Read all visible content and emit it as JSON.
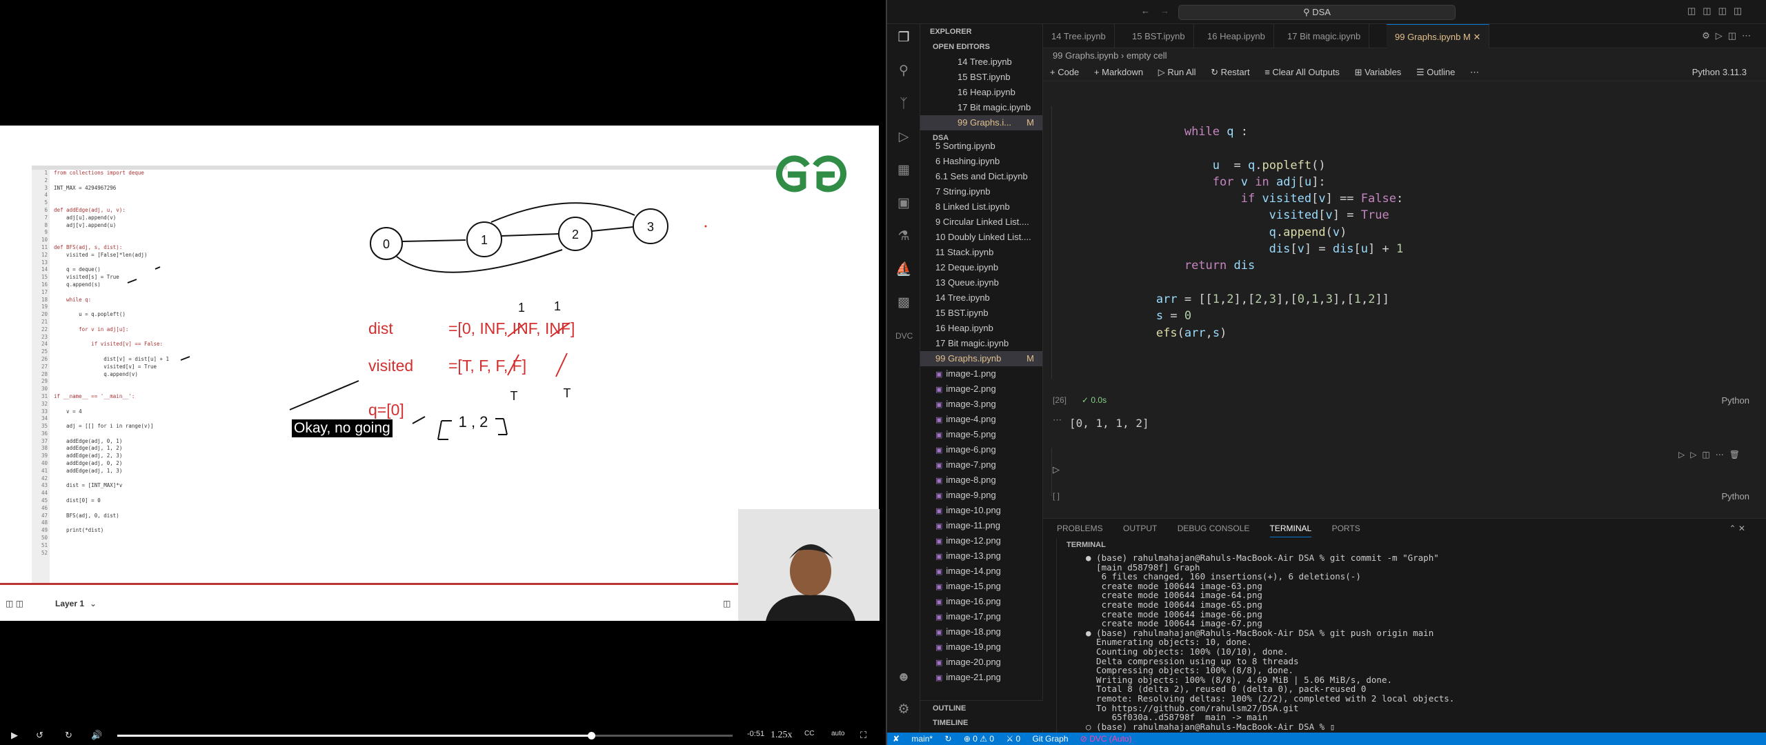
{
  "video": {
    "layer": "Layer 1",
    "time": "-0:51",
    "speed": "1.25x",
    "quality": "auto",
    "caption": "Okay, no going",
    "progress": 0.77
  },
  "slide": {
    "code_lines": [
      "from collections import deque",
      "",
      "INT_MAX = 4294967296",
      "",
      "",
      "def addEdge(adj, u, v):",
      "    adj[u].append(v)",
      "    adj[v].append(u)",
      "",
      "",
      "def BFS(adj, s, dist):",
      "    visited = [False]*len(adj)",
      "",
      "    q = deque()",
      "    visited[s] = True",
      "    q.append(s)",
      "",
      "    while q:",
      "",
      "        u = q.popleft()",
      "",
      "        for v in adj[u]:",
      "",
      "            if visited[v] == False:",
      "",
      "                dist[v] = dist[u] + 1",
      "                visited[v] = True",
      "                q.append(v)",
      "",
      "",
      "if __name__ == '__main__':",
      "",
      "    v = 4",
      "",
      "    adj = [[] for i in range(v)]",
      "",
      "    addEdge(adj, 0, 1)",
      "    addEdge(adj, 1, 2)",
      "    addEdge(adj, 2, 3)",
      "    addEdge(adj, 0, 2)",
      "    addEdge(adj, 1, 3)",
      "",
      "    dist = [INT_MAX]*v",
      "",
      "    dist[0] = 0",
      "",
      "    BFS(adj, 0, dist)",
      "",
      "    print(*dist)",
      "",
      "",
      ""
    ],
    "nodes": [
      "0",
      "1",
      "2",
      "3"
    ],
    "dist_label": "dist",
    "dist_val": "=[0,  INF,  INF,   INF]",
    "visited_label": "visited",
    "visited_val": "=[T,    F,    F,     F]",
    "q_label": "q=[0]",
    "q_val": "1 , 2",
    "mark1": "1",
    "mark2": "1",
    "markT1": "T",
    "markT2": "T"
  },
  "vscode": {
    "search": "DSA",
    "explorer": "EXPLORER",
    "open_editors": "OPEN EDITORS",
    "open_files": [
      {
        "name": "14 Tree.ipynb"
      },
      {
        "name": "15 BST.ipynb"
      },
      {
        "name": "16 Heap.ipynb"
      },
      {
        "name": "17 Bit magic.ipynb"
      },
      {
        "name": "99 Graphs.i...",
        "m": "M"
      }
    ],
    "folder": "DSA",
    "files": [
      {
        "name": "5 Sorting.ipynb"
      },
      {
        "name": "6 Hashing.ipynb"
      },
      {
        "name": "6.1 Sets and Dict.ipynb"
      },
      {
        "name": "7 String.ipynb"
      },
      {
        "name": "8 Linked List.ipynb"
      },
      {
        "name": "9 Circular Linked List...."
      },
      {
        "name": "10 Doubly Linked List...."
      },
      {
        "name": "11 Stack.ipynb"
      },
      {
        "name": "12 Deque.ipynb"
      },
      {
        "name": "13 Queue.ipynb"
      },
      {
        "name": "14 Tree.ipynb"
      },
      {
        "name": "15 BST.ipynb"
      },
      {
        "name": "16 Heap.ipynb"
      },
      {
        "name": "17 Bit magic.ipynb"
      },
      {
        "name": "99 Graphs.ipynb",
        "m": "M"
      }
    ],
    "images": [
      "image-1.png",
      "image-2.png",
      "image-3.png",
      "image-4.png",
      "image-5.png",
      "image-6.png",
      "image-7.png",
      "image-8.png",
      "image-9.png",
      "image-10.png",
      "image-11.png",
      "image-12.png",
      "image-13.png",
      "image-14.png",
      "image-15.png",
      "image-16.png",
      "image-17.png",
      "image-18.png",
      "image-19.png",
      "image-20.png",
      "image-21.png"
    ],
    "outline": "OUTLINE",
    "timeline": "TIMELINE",
    "tabs": [
      "14 Tree.ipynb",
      "15 BST.ipynb",
      "16 Heap.ipynb",
      "17 Bit magic.ipynb",
      "99 Graphs.ipynb"
    ],
    "active_tab_mark": "M",
    "breadcrumb": "99 Graphs.ipynb  ›  empty cell",
    "toolbar": {
      "code": "+ Code",
      "markdown": "+ Markdown",
      "run_all": "▷ Run All",
      "restart": "↻ Restart",
      "clear": "≡ Clear All Outputs",
      "variables": "⊞ Variables",
      "outline": "☰ Outline",
      "kernel": "Python 3.11.3"
    },
    "exec_count": "[26]",
    "exec_time": "✓  0.0s",
    "lang": "Python",
    "lang2": "Python",
    "output": "[0, 1, 1, 2]",
    "empty_cell": "[ ]",
    "panel_tabs": [
      "PROBLEMS",
      "OUTPUT",
      "DEBUG CONSOLE",
      "TERMINAL",
      "PORTS"
    ],
    "terminal_title": "TERMINAL",
    "terminal": "● (base) rahulmahajan@Rahuls-MacBook-Air DSA % git commit -m \"Graph\"\n  [main d58798f] Graph\n   6 files changed, 160 insertions(+), 6 deletions(-)\n   create mode 100644 image-63.png\n   create mode 100644 image-64.png\n   create mode 100644 image-65.png\n   create mode 100644 image-66.png\n   create mode 100644 image-67.png\n● (base) rahulmahajan@Rahuls-MacBook-Air DSA % git push origin main\n  Enumerating objects: 10, done.\n  Counting objects: 100% (10/10), done.\n  Delta compression using up to 8 threads\n  Compressing objects: 100% (8/8), done.\n  Writing objects: 100% (8/8), 4.69 MiB | 5.06 MiB/s, done.\n  Total 8 (delta 2), reused 0 (delta 0), pack-reused 0\n  remote: Resolving deltas: 100% (2/2), completed with 2 local objects.\n  To https://github.com/rahulsm27/DSA.git\n     65f030a..d58798f  main -> main\n○ (base) rahulmahajan@Rahuls-MacBook-Air DSA % ▯",
    "status": {
      "branch": "main*",
      "sync": "↻",
      "remote": "⊕ 0 ⚠ 0",
      "ports": "⚔ 0",
      "graph": "Git Graph",
      "dvc": "⊘ DVC (Auto)"
    }
  },
  "colors": {
    "red": "#d32f2f",
    "accent": "#0078d4"
  }
}
